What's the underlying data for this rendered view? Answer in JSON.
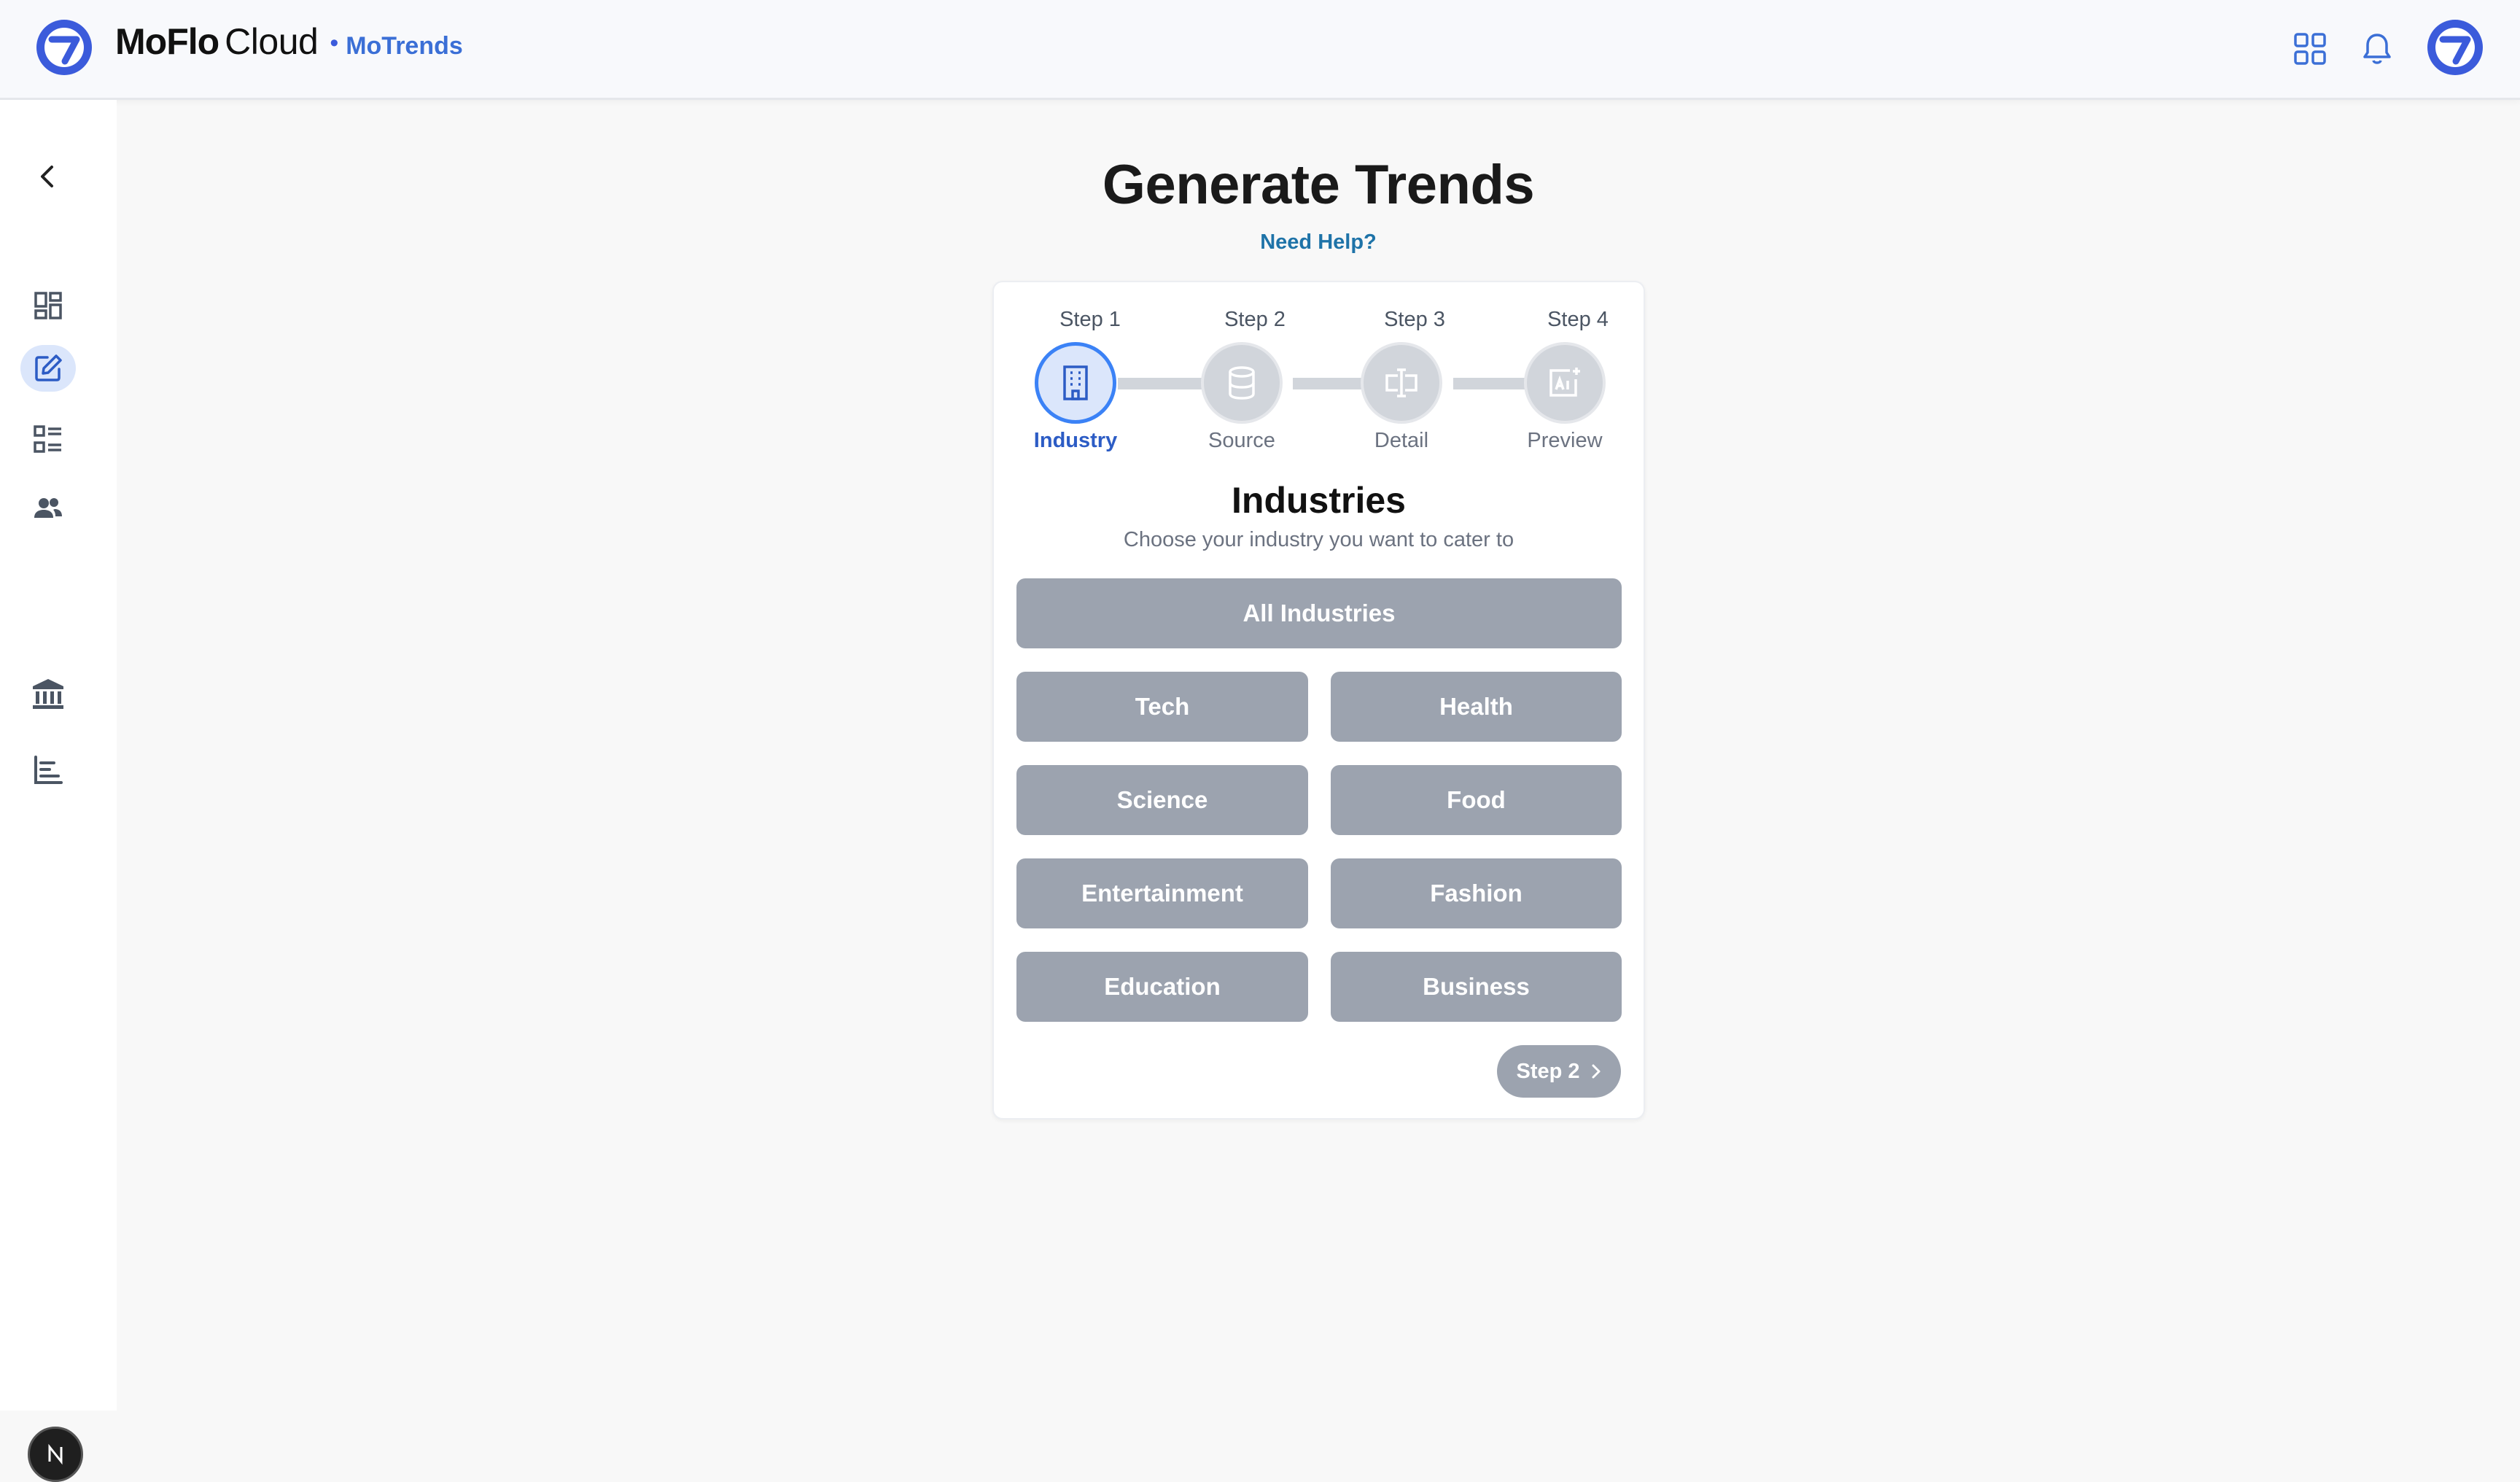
{
  "header": {
    "brand_bold": "MoFlo",
    "brand_light": "Cloud",
    "separator": "•",
    "app_name": "MoTrends",
    "icons": [
      "apps-grid-icon",
      "bell-icon",
      "profile-avatar"
    ]
  },
  "sidebar": {
    "items": [
      {
        "icon": "chevron-left-icon"
      },
      {
        "icon": "dashboard-icon"
      },
      {
        "icon": "edit-icon",
        "active": true
      },
      {
        "icon": "list-icon"
      },
      {
        "icon": "users-icon"
      },
      {
        "icon": "bank-icon"
      },
      {
        "icon": "bar-chart-icon"
      }
    ],
    "badge": "N"
  },
  "page": {
    "title": "Generate Trends",
    "help_link": "Need Help?"
  },
  "stepper": {
    "steps": [
      {
        "label": "Step 1",
        "name": "Industry",
        "icon": "building-icon",
        "active": true
      },
      {
        "label": "Step 2",
        "name": "Source",
        "icon": "database-icon",
        "active": false
      },
      {
        "label": "Step 3",
        "name": "Detail",
        "icon": "text-cursor-icon",
        "active": false
      },
      {
        "label": "Step 4",
        "name": "Preview",
        "icon": "ai-image-icon",
        "active": false
      }
    ]
  },
  "section": {
    "title": "Industries",
    "subtitle": "Choose your industry you want to cater to"
  },
  "industries": {
    "all": "All Industries",
    "options": [
      "Tech",
      "Health",
      "Science",
      "Food",
      "Entertainment",
      "Fashion",
      "Education",
      "Business"
    ]
  },
  "next_button": {
    "label": "Step 2",
    "icon": "chevron-right-icon"
  },
  "colors": {
    "accent": "#3b82f6",
    "brand": "#3b6fd6",
    "option_bg": "#9ca3af",
    "help_link": "#1e73a8"
  }
}
